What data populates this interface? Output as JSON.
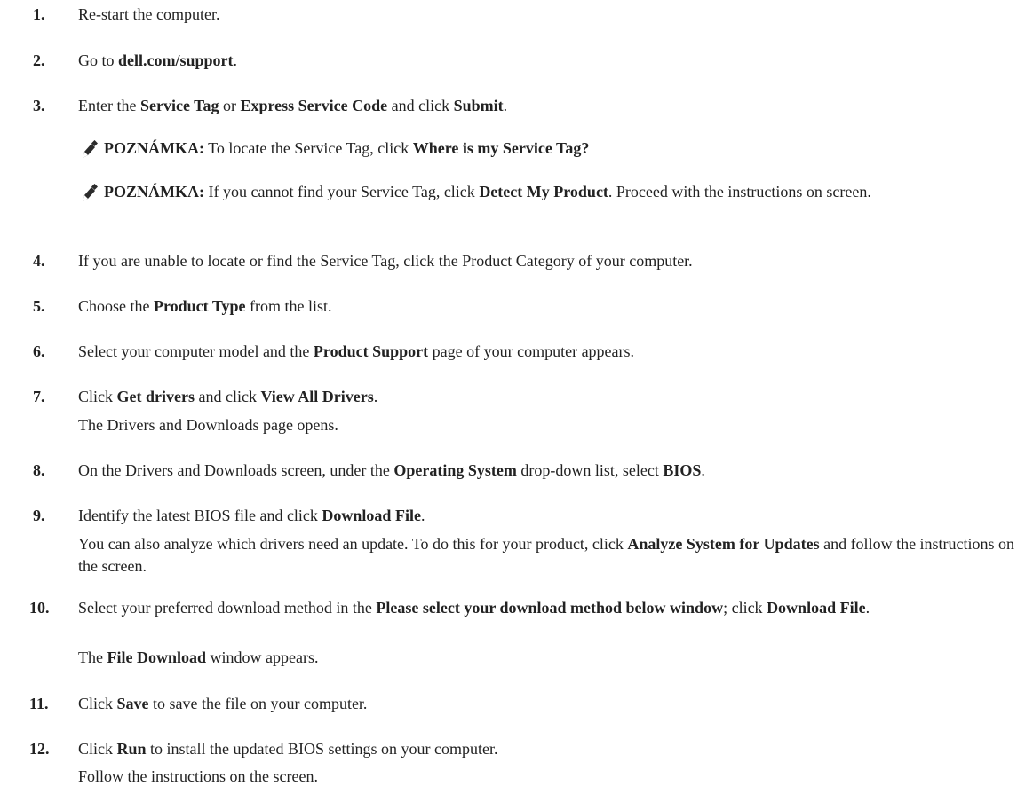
{
  "steps": [
    {
      "n": "1.",
      "parts": [
        {
          "t": "Re-start the computer."
        }
      ]
    },
    {
      "n": "2.",
      "parts": [
        {
          "t": "Go to "
        },
        {
          "t": "dell.com/support",
          "b": true
        },
        {
          "t": "."
        }
      ]
    },
    {
      "n": "3.",
      "parts": [
        {
          "t": "Enter the "
        },
        {
          "t": "Service Tag",
          "b": true
        },
        {
          "t": " or "
        },
        {
          "t": "Express Service Code",
          "b": true
        },
        {
          "t": " and click "
        },
        {
          "t": "Submit",
          "b": true
        },
        {
          "t": "."
        }
      ]
    },
    {
      "n": "4.",
      "parts": [
        {
          "t": "If you are unable to locate or find the Service Tag, click the Product Category of your computer."
        }
      ]
    },
    {
      "n": "5.",
      "parts": [
        {
          "t": "Choose the "
        },
        {
          "t": "Product Type",
          "b": true
        },
        {
          "t": " from the list."
        }
      ]
    },
    {
      "n": "6.",
      "parts": [
        {
          "t": "Select your computer model and the "
        },
        {
          "t": "Product Support",
          "b": true
        },
        {
          "t": " page of your computer appears."
        }
      ]
    },
    {
      "n": "7.",
      "parts": [
        {
          "t": "Click "
        },
        {
          "t": "Get drivers",
          "b": true
        },
        {
          "t": " and click "
        },
        {
          "t": "View All Drivers",
          "b": true
        },
        {
          "t": "."
        }
      ]
    },
    {
      "n": "8.",
      "parts": [
        {
          "t": "On the Drivers and Downloads screen, under the "
        },
        {
          "t": "Operating System",
          "b": true
        },
        {
          "t": " drop-down list, select "
        },
        {
          "t": "BIOS",
          "b": true
        },
        {
          "t": "."
        }
      ]
    },
    {
      "n": "9.",
      "parts": [
        {
          "t": "Identify the latest BIOS file and click "
        },
        {
          "t": "Download File",
          "b": true
        },
        {
          "t": "."
        }
      ]
    },
    {
      "n": "10.",
      "parts": [
        {
          "t": "Select your preferred download method in the "
        },
        {
          "t": "Please select your download method below window",
          "b": true
        },
        {
          "t": "; click "
        },
        {
          "t": "Download File",
          "b": true
        },
        {
          "t": "."
        }
      ]
    },
    {
      "n": "11.",
      "parts": [
        {
          "t": "Click "
        },
        {
          "t": "Save",
          "b": true
        },
        {
          "t": " to save the file on your computer."
        }
      ]
    },
    {
      "n": "12.",
      "parts": [
        {
          "t": "Click "
        },
        {
          "t": "Run",
          "b": true
        },
        {
          "t": " to install the updated BIOS settings on your computer."
        }
      ]
    }
  ],
  "notes": [
    {
      "parts": [
        {
          "t": "POZNÁMKA:",
          "b": true
        },
        {
          "t": " To locate the Service Tag, click "
        },
        {
          "t": "Where is my Service Tag?",
          "b": true
        }
      ]
    },
    {
      "parts": [
        {
          "t": "POZNÁMKA:",
          "b": true
        },
        {
          "t": " If you cannot find your Service Tag, click "
        },
        {
          "t": "Detect My Product",
          "b": true
        },
        {
          "t": ". Proceed with the instructions on screen."
        }
      ]
    }
  ],
  "continuations": [
    {
      "parts": [
        {
          "t": "The Drivers and Downloads page opens."
        }
      ]
    },
    {
      "parts": [
        {
          "t": "You can also analyze which drivers need an update. To do this for your product, click "
        },
        {
          "t": "Analyze System for Updates",
          "b": true
        },
        {
          "t": " and follow the instructions on the screen."
        }
      ]
    },
    {
      "parts": [
        {
          "t": "The "
        },
        {
          "t": "File Download",
          "b": true
        },
        {
          "t": " window appears."
        }
      ]
    },
    {
      "parts": [
        {
          "t": "Follow the instructions on the screen."
        }
      ]
    }
  ]
}
